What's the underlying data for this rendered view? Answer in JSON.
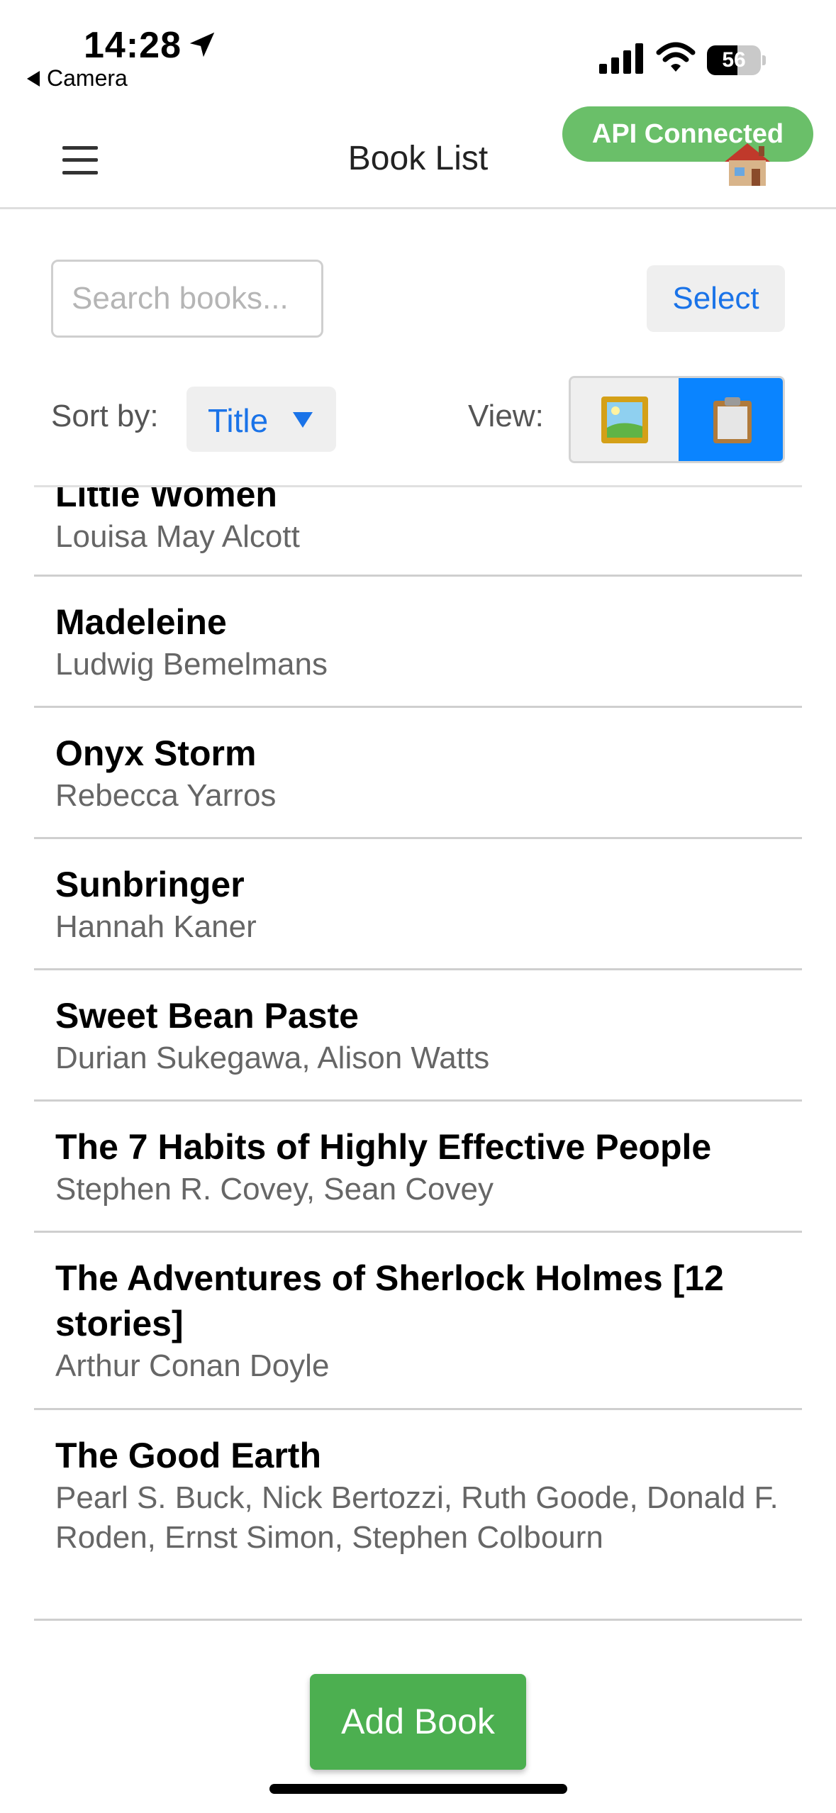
{
  "status_bar": {
    "time": "14:28",
    "back_app": "Camera",
    "battery_level": "56",
    "battery_fraction": 0.56,
    "icons": [
      "location-arrow-icon",
      "cellular-signal-icon",
      "wifi-icon",
      "battery-icon"
    ]
  },
  "header": {
    "title": "Book List",
    "api_status": "API Connected",
    "api_status_color": "#6abf69",
    "menu_icon": "hamburger-menu-icon",
    "home_icon": "house-emoji-icon"
  },
  "search": {
    "placeholder": "Search books...",
    "value": "",
    "select_label": "Select"
  },
  "controls": {
    "sort_label": "Sort by:",
    "sort_value": "Title",
    "view_label": "View:",
    "view_options": [
      "grid-picture-icon",
      "list-clipboard-icon"
    ],
    "selected_view": "list",
    "accent_color": "#0a84ff"
  },
  "books": [
    {
      "title": "Little Women",
      "author": "Louisa May Alcott"
    },
    {
      "title": "Madeleine",
      "author": "Ludwig Bemelmans"
    },
    {
      "title": "Onyx Storm",
      "author": "Rebecca Yarros"
    },
    {
      "title": "Sunbringer",
      "author": "Hannah Kaner"
    },
    {
      "title": "Sweet Bean Paste",
      "author": "Durian Sukegawa, Alison Watts"
    },
    {
      "title": "The 7 Habits of Highly Effective People",
      "author": "Stephen R. Covey, Sean Covey"
    },
    {
      "title": "The Adventures of Sherlock Holmes [12 stories]",
      "author": "Arthur Conan Doyle"
    },
    {
      "title": "The Good Earth",
      "author": "Pearl S. Buck, Nick Bertozzi, Ruth Goode, Donald F. Roden, Ernst Simon, Stephen Colbourn"
    }
  ],
  "actions": {
    "add_book_label": "Add Book",
    "add_book_color": "#4caf50"
  }
}
